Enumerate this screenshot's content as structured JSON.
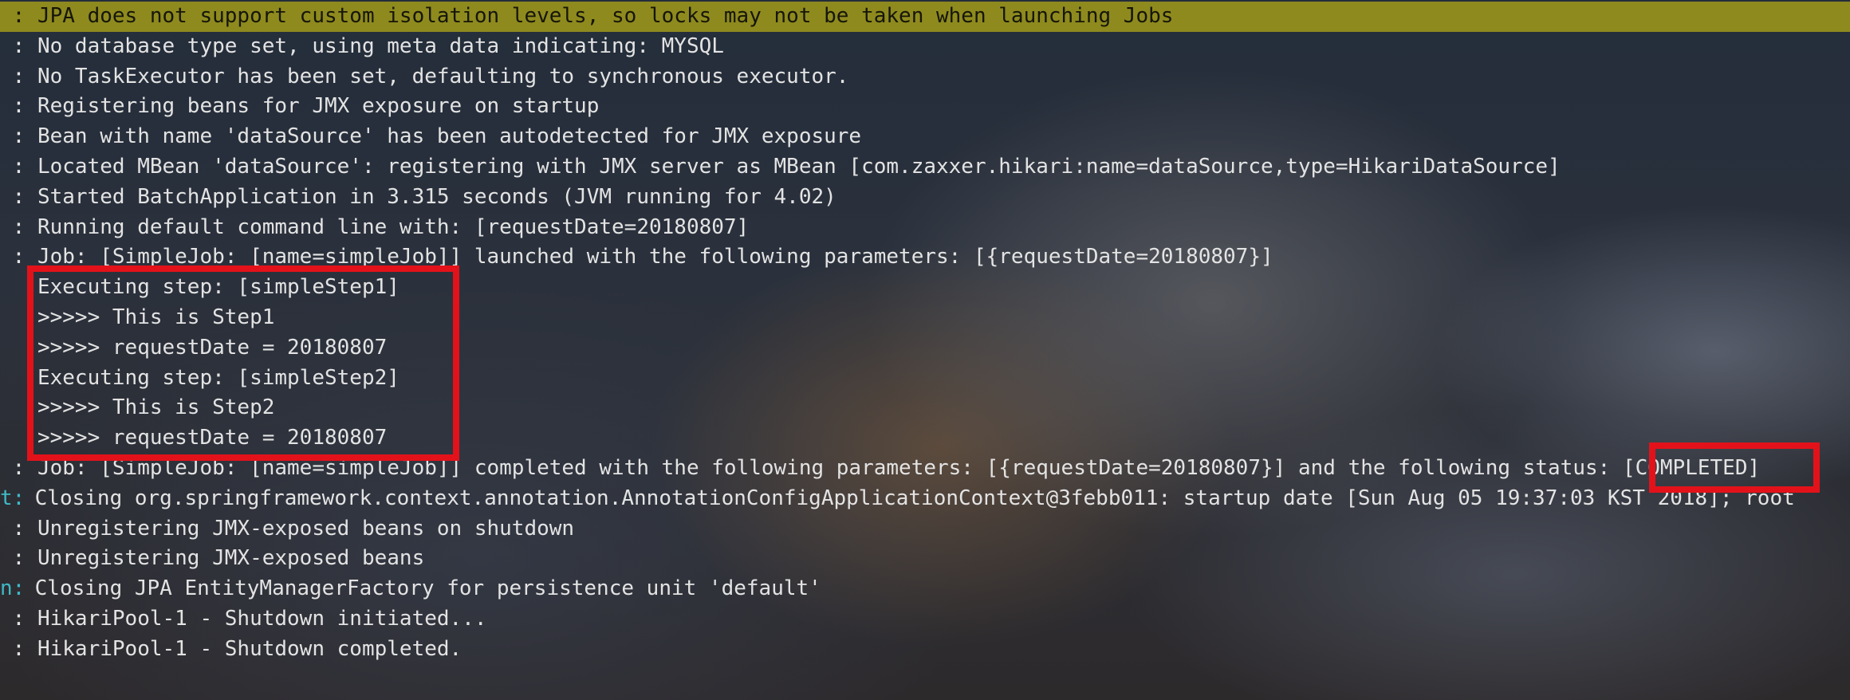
{
  "terminal": {
    "lines": [
      {
        "prefix": " :",
        "text": " JPA does not support custom isolation levels, so locks may not be taken when launching Jobs"
      },
      {
        "prefix": " :",
        "text": " No database type set, using meta data indicating: MYSQL"
      },
      {
        "prefix": " :",
        "text": " No TaskExecutor has been set, defaulting to synchronous executor."
      },
      {
        "prefix": " :",
        "text": " Registering beans for JMX exposure on startup"
      },
      {
        "prefix": " :",
        "text": " Bean with name 'dataSource' has been autodetected for JMX exposure"
      },
      {
        "prefix": " :",
        "text": " Located MBean 'dataSource': registering with JMX server as MBean [com.zaxxer.hikari:name=dataSource,type=HikariDataSource]"
      },
      {
        "prefix": " :",
        "text": " Started BatchApplication in 3.315 seconds (JVM running for 4.02)"
      },
      {
        "prefix": " :",
        "text": " Running default command line with: [requestDate=20180807]"
      },
      {
        "prefix": " :",
        "text": " Job: [SimpleJob: [name=simpleJob]] launched with the following parameters: [{requestDate=20180807}]"
      },
      {
        "prefix": "  ",
        "text": " Executing step: [simpleStep1]"
      },
      {
        "prefix": "  ",
        "text": " >>>>> This is Step1"
      },
      {
        "prefix": "  ",
        "text": " >>>>> requestDate = 20180807"
      },
      {
        "prefix": "  ",
        "text": " Executing step: [simpleStep2]"
      },
      {
        "prefix": "  ",
        "text": " >>>>> This is Step2"
      },
      {
        "prefix": "  ",
        "text": " >>>>> requestDate = 20180807"
      },
      {
        "prefix": " :",
        "text": " Job: [SimpleJob: [name=simpleJob]] completed with the following parameters: [{requestDate=20180807}] and the following status: [COMPLETED]"
      },
      {
        "prefix": "t:",
        "text": " Closing org.springframework.context.annotation.AnnotationConfigApplicationContext@3febb011: startup date [Sun Aug 05 19:37:03 KST 2018]; root"
      },
      {
        "prefix": " :",
        "text": " Unregistering JMX-exposed beans on shutdown"
      },
      {
        "prefix": " :",
        "text": " Unregistering JMX-exposed beans"
      },
      {
        "prefix": "n:",
        "text": " Closing JPA EntityManagerFactory for persistence unit 'default'"
      },
      {
        "prefix": " :",
        "text": " HikariPool-1 - Shutdown initiated..."
      },
      {
        "prefix": " :",
        "text": " HikariPool-1 - Shutdown completed."
      }
    ]
  },
  "colors": {
    "highlight_bg": "#8e8a1e",
    "annotation_border": "#e3121a",
    "gutter_accent": "#3fb9c6",
    "text": "#e3e3e3"
  }
}
